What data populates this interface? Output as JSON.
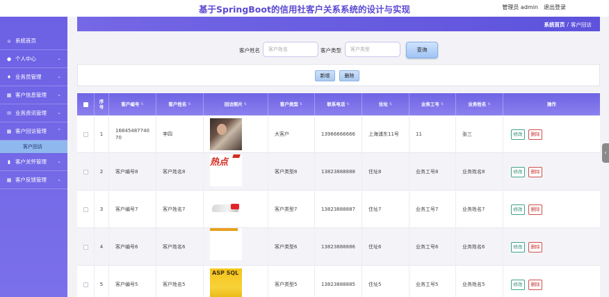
{
  "header": {
    "title": "基于SpringBoot的信用社客户关系系统的设计与实现",
    "user": "管理员 admin",
    "logout": "退出登录"
  },
  "sidebar": {
    "items": [
      {
        "label": "系统首页",
        "icon": "home-icon"
      },
      {
        "label": "个人中心",
        "icon": "user-icon"
      },
      {
        "label": "业务员管理",
        "icon": "shield-icon"
      },
      {
        "label": "客户信息管理",
        "icon": "grid-icon"
      },
      {
        "label": "业务资讯管理",
        "icon": "mail-icon"
      },
      {
        "label": "客户回访管理",
        "icon": "grid-icon"
      },
      {
        "label": "客户关怀管理",
        "icon": "book-icon"
      },
      {
        "label": "客户反馈管理",
        "icon": "grid-icon"
      }
    ],
    "sub_item": "客户回访"
  },
  "breadcrumb": {
    "home": "系统首页",
    "separator": "/",
    "current": "客户回访"
  },
  "search": {
    "name_label": "客户姓名",
    "name_placeholder": "客户姓名",
    "type_label": "客户类型",
    "type_placeholder": "客户类型",
    "button": "查询"
  },
  "actions": {
    "add": "新增",
    "delete": "删除"
  },
  "table": {
    "columns": [
      "序号",
      "客户编号",
      "客户姓名",
      "回访照片",
      "客户类型",
      "联系电话",
      "住址",
      "业务工号",
      "业务姓名",
      "操作"
    ],
    "edit_label": "修改",
    "delete_label": "删除",
    "rows": [
      {
        "index": "1",
        "customer_no": "1684548774070",
        "name": "李四",
        "type": "大客户",
        "phone": "13966666666",
        "address": "上海浦东11号",
        "staff_no": "11",
        "staff_name": "张三"
      },
      {
        "index": "2",
        "customer_no": "客户编号8",
        "name": "客户姓名8",
        "type": "客户类型8",
        "phone": "13823888888",
        "address": "住址8",
        "staff_no": "业务工号8",
        "staff_name": "业务姓名8"
      },
      {
        "index": "3",
        "customer_no": "客户编号7",
        "name": "客户姓名7",
        "type": "客户类型7",
        "phone": "13823888887",
        "address": "住址7",
        "staff_no": "业务工号7",
        "staff_name": "业务姓名7"
      },
      {
        "index": "4",
        "customer_no": "客户编号6",
        "name": "客户姓名6",
        "type": "客户类型6",
        "phone": "13823888886",
        "address": "住址6",
        "staff_no": "业务工号6",
        "staff_name": "业务姓名6"
      },
      {
        "index": "5",
        "customer_no": "客户编号5",
        "name": "客户姓名5",
        "type": "客户类型5",
        "phone": "13823888885",
        "address": "住址5",
        "staff_no": "业务工号5",
        "staff_name": "业务姓名5"
      }
    ]
  },
  "photos": {
    "hot_text": "热点",
    "book_text": "ASP SQL"
  }
}
